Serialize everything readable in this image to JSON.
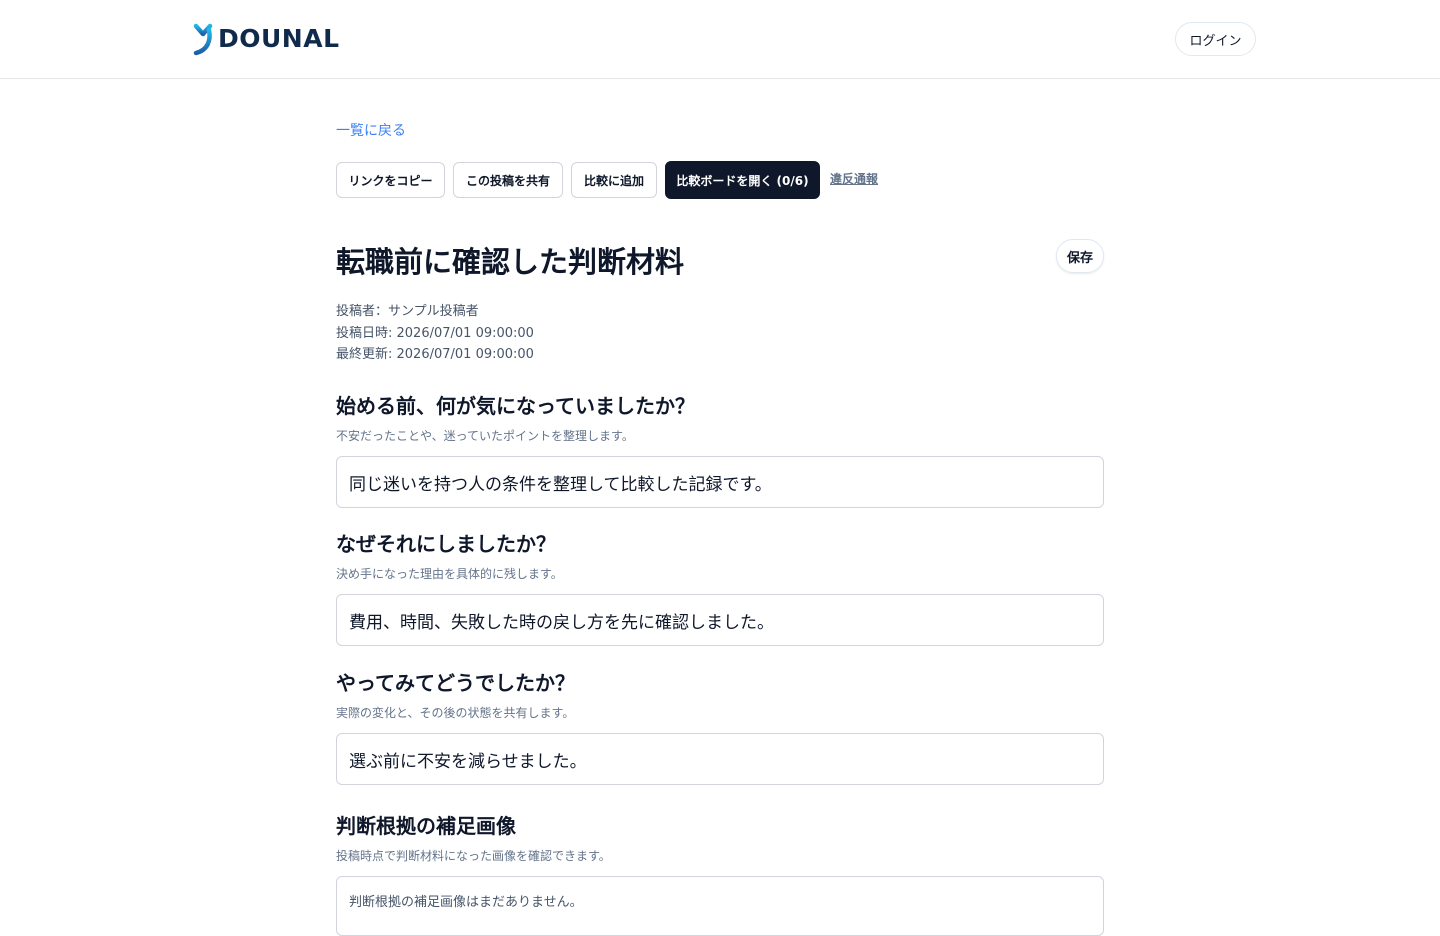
{
  "header": {
    "logo_text": "DOUNAL",
    "logo_icon": "dounal-logo-icon",
    "login_label": "ログイン"
  },
  "nav": {
    "back_label": "一覧に戻る"
  },
  "actions": {
    "copy_link": "リンクをコピー",
    "share": "この投稿を共有",
    "add_compare": "比較に追加",
    "open_board": "比較ボードを開く (0/6)",
    "report": "違反通報"
  },
  "post": {
    "title": "転職前に確認した判断材料",
    "save_label": "保存",
    "author": "投稿者：サンプル投稿者",
    "posted_at": "投稿日時: 2026/07/01 09:00:00",
    "updated_at": "最終更新: 2026/07/01 09:00:00"
  },
  "sections": [
    {
      "title": "始める前、何が気になっていましたか？",
      "subtitle": "不安だったことや、迷っていたポイントを整理します。",
      "answer": "同じ迷いを持つ人の条件を整理して比較した記録です。"
    },
    {
      "title": "なぜそれにしましたか？",
      "subtitle": "決め手になった理由を具体的に残します。",
      "answer": "費用、時間、失敗した時の戻し方を先に確認しました。"
    },
    {
      "title": "やってみてどうでしたか？",
      "subtitle": "実際の変化と、その後の状態を共有します。",
      "answer": "選ぶ前に不安を減らせました。"
    }
  ],
  "images": {
    "title": "判断根拠の補足画像",
    "subtitle": "投稿時点で判断材料になった画像を確認できます。",
    "empty": "判断根拠の補足画像はまだありません。"
  },
  "colors": {
    "accent": "#3b82f6",
    "dark_button": "#0f172a",
    "logo_gradient_start": "#22b8e6",
    "logo_gradient_end": "#1e5fa8"
  }
}
